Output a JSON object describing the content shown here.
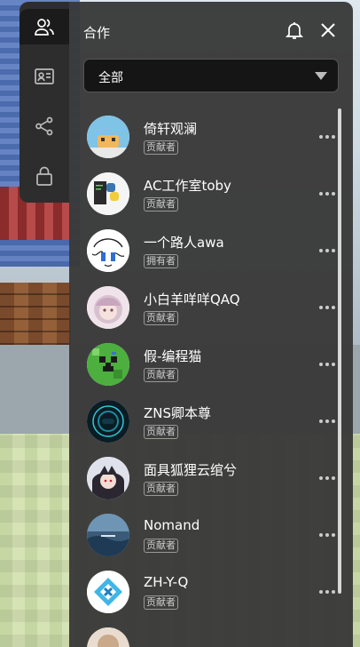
{
  "panel": {
    "title": "合作"
  },
  "filter": {
    "selected": "全部"
  },
  "members": [
    {
      "name": "倚轩观澜",
      "role": "贡献者",
      "avatar": "cat-avatar"
    },
    {
      "name": "AC工作室toby",
      "role": "贡献者",
      "avatar": "python-logo-avatar"
    },
    {
      "name": "一个路人awa",
      "role": "拥有者",
      "avatar": "sketch-character-avatar"
    },
    {
      "name": "小白羊咩咩QAQ",
      "role": "贡献者",
      "avatar": "anime-girl-avatar"
    },
    {
      "name": "假-编程猫",
      "role": "贡献者",
      "avatar": "creeper-avatar"
    },
    {
      "name": "ZNS卿本尊",
      "role": "贡献者",
      "avatar": "tech-circle-avatar"
    },
    {
      "name": "面具狐狸云绾兮",
      "role": "贡献者",
      "avatar": "anime-fox-avatar"
    },
    {
      "name": "Nomand",
      "role": "贡献者",
      "avatar": "ocean-avatar"
    },
    {
      "name": "ZH-Y-Q",
      "role": "贡献者",
      "avatar": "blue-logo-avatar"
    }
  ],
  "colors": {
    "panel": "#3a3a3a",
    "sidebar": "#2d2d2d",
    "dropdown": "#151515",
    "text": "#ffffff"
  }
}
